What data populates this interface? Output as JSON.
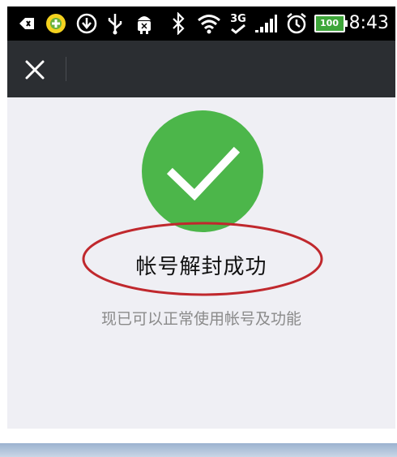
{
  "status_bar": {
    "time": "8:43",
    "battery_level": "100",
    "network_type": "3G",
    "icons": [
      "back-arrow-icon",
      "app-notification-icon",
      "download-icon",
      "usb-icon",
      "android-debug-icon",
      "bluetooth-icon",
      "wifi-icon",
      "network-3g-icon",
      "signal-icon",
      "alarm-icon",
      "battery-icon"
    ]
  },
  "title_bar": {
    "close_icon": "close-icon"
  },
  "result": {
    "icon": "check-icon",
    "title": "帐号解封成功",
    "description": "现已可以正常使用帐号及功能"
  },
  "colors": {
    "success_green": "#4cb64a",
    "title_bar": "#2b2e32",
    "background": "#efeff4",
    "annotation_red": "#c0282d"
  }
}
